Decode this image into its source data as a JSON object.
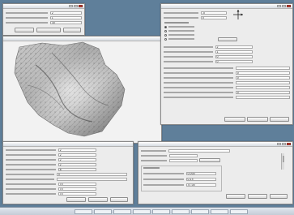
{
  "windows": {
    "params_top_left": {
      "title": "",
      "fields": [
        {
          "label": "",
          "value": "2"
        },
        {
          "label": "",
          "value": "1"
        },
        {
          "label": "",
          "value": "30"
        }
      ],
      "buttons": [
        "",
        "",
        ""
      ]
    },
    "terrain": {
      "title": ""
    },
    "params_right": {
      "title": "",
      "fields_top": [
        {
          "label": "",
          "value": "-0"
        },
        {
          "label": "",
          "value": "0"
        }
      ],
      "radio_group_label": "",
      "radios": [
        {
          "label": "",
          "selected": true
        },
        {
          "label": "",
          "selected": false
        },
        {
          "label": "",
          "selected": false
        },
        {
          "label": "",
          "selected": false
        }
      ],
      "fields_mid": [
        {
          "label": "",
          "value": "2"
        },
        {
          "label": "",
          "value": "1"
        },
        {
          "label": "",
          "value": "0"
        },
        {
          "label": "",
          "value": "0"
        }
      ],
      "fields_low": [
        {
          "label": "",
          "value": ""
        },
        {
          "label": "",
          "value": "0"
        },
        {
          "label": "",
          "value": "0"
        },
        {
          "label": "",
          "value": ""
        },
        {
          "label": "",
          "value": ""
        },
        {
          "label": "",
          "value": "0"
        },
        {
          "label": "",
          "value": ""
        }
      ],
      "buttons": [
        "",
        "",
        ""
      ]
    },
    "params_bottom_left": {
      "title": "",
      "fields": [
        {
          "label": "",
          "value": "2"
        },
        {
          "label": "",
          "value": "2"
        },
        {
          "label": "",
          "value": "2"
        },
        {
          "label": "",
          "value": "2"
        },
        {
          "label": "",
          "value": "8"
        },
        {
          "label": "",
          "value": "0"
        },
        {
          "label": "",
          "value": ""
        },
        {
          "label": "",
          "value": "70"
        },
        {
          "label": "",
          "value": "70"
        },
        {
          "label": "",
          "value": "70"
        }
      ],
      "buttons": [
        "",
        "",
        ""
      ]
    },
    "params_bottom_mid": {
      "title": "",
      "fields_top": [
        {
          "label": "",
          "value": ""
        },
        {
          "label": "",
          "value": ""
        },
        {
          "label": "",
          "value": ""
        }
      ],
      "section_label": "",
      "fields_low": [
        {
          "label": "",
          "value": "0.000"
        },
        {
          "label": "",
          "value": "0.15"
        },
        {
          "label": "",
          "value": "37.00"
        }
      ],
      "buttons": [
        "",
        "",
        ""
      ]
    }
  },
  "taskbar": {
    "status_text": ""
  }
}
